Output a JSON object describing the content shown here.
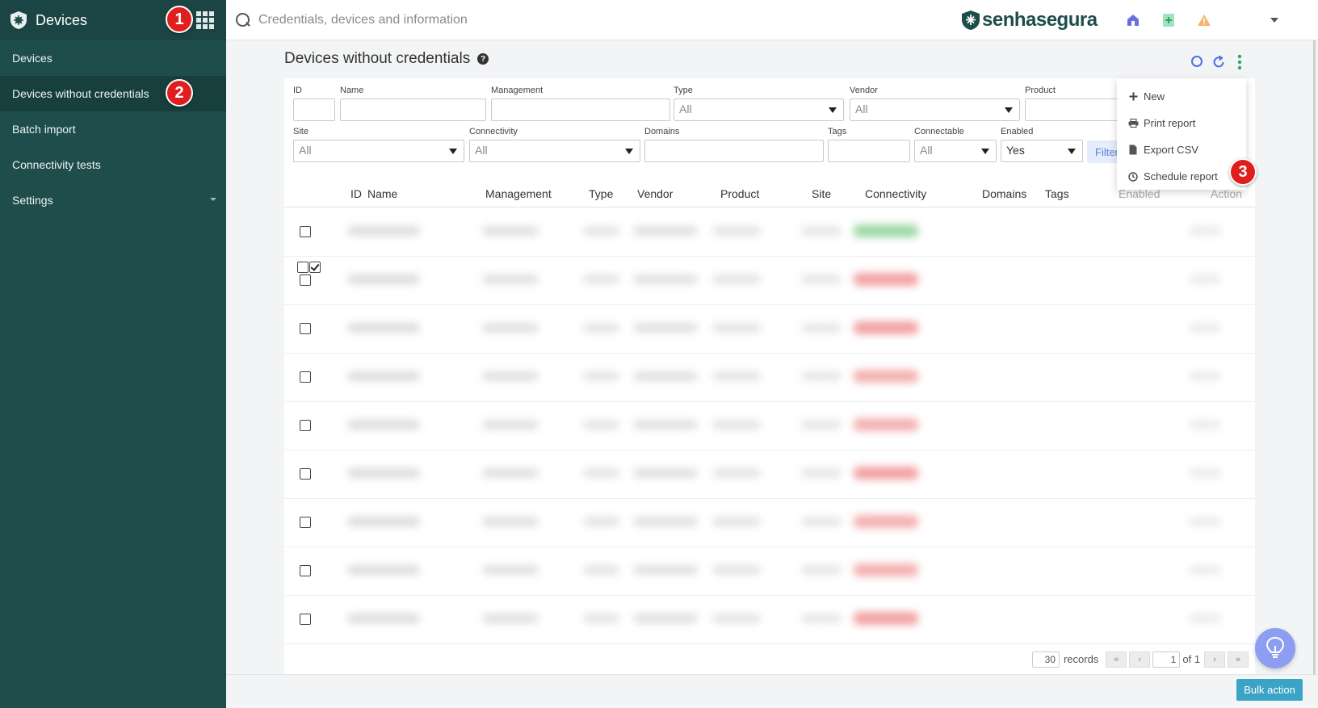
{
  "sidebar": {
    "title": "Devices",
    "items": [
      {
        "label": "Devices"
      },
      {
        "label": "Devices without credentials"
      },
      {
        "label": "Batch import"
      },
      {
        "label": "Connectivity tests"
      },
      {
        "label": "Settings"
      }
    ]
  },
  "topbar": {
    "search_placeholder": "Credentials, devices and information",
    "brand": "senhasegura"
  },
  "page": {
    "title": "Devices without credentials"
  },
  "filters": {
    "id": {
      "label": "ID",
      "value": ""
    },
    "name": {
      "label": "Name",
      "value": ""
    },
    "management": {
      "label": "Management",
      "value": ""
    },
    "type": {
      "label": "Type",
      "value": "All"
    },
    "vendor": {
      "label": "Vendor",
      "value": "All"
    },
    "product": {
      "label": "Product",
      "value": ""
    },
    "site": {
      "label": "Site",
      "value": "All"
    },
    "connectivity": {
      "label": "Connectivity",
      "value": "All"
    },
    "domains": {
      "label": "Domains",
      "value": ""
    },
    "tags": {
      "label": "Tags",
      "value": ""
    },
    "connectable": {
      "label": "Connectable",
      "value": "All"
    },
    "enabled": {
      "label": "Enabled",
      "value": "Yes"
    },
    "filter_button": "Filter"
  },
  "table": {
    "columns": [
      "ID",
      "Name",
      "Management",
      "Type",
      "Vendor",
      "Product",
      "Site",
      "Connectivity",
      "Domains",
      "Tags",
      "Enabled",
      "Action"
    ],
    "row_count": 9
  },
  "pager": {
    "page_size": "30",
    "records_label": "records",
    "current_page": "1",
    "of_label": "of 1",
    "first": "«",
    "prev": "‹",
    "next": "›",
    "last": "»"
  },
  "actions_menu": {
    "items": [
      {
        "label": "New",
        "icon": "plus-icon"
      },
      {
        "label": "Print report",
        "icon": "printer-icon"
      },
      {
        "label": "Export CSV",
        "icon": "file-icon"
      },
      {
        "label": "Schedule report",
        "icon": "clock-icon"
      }
    ]
  },
  "bulk_action": "Bulk action",
  "annotations": [
    "1",
    "2",
    "3"
  ],
  "colors": {
    "sidebar": "#1e4d4b",
    "accent": "#3aa3c6",
    "badge": "#e01e1e"
  }
}
